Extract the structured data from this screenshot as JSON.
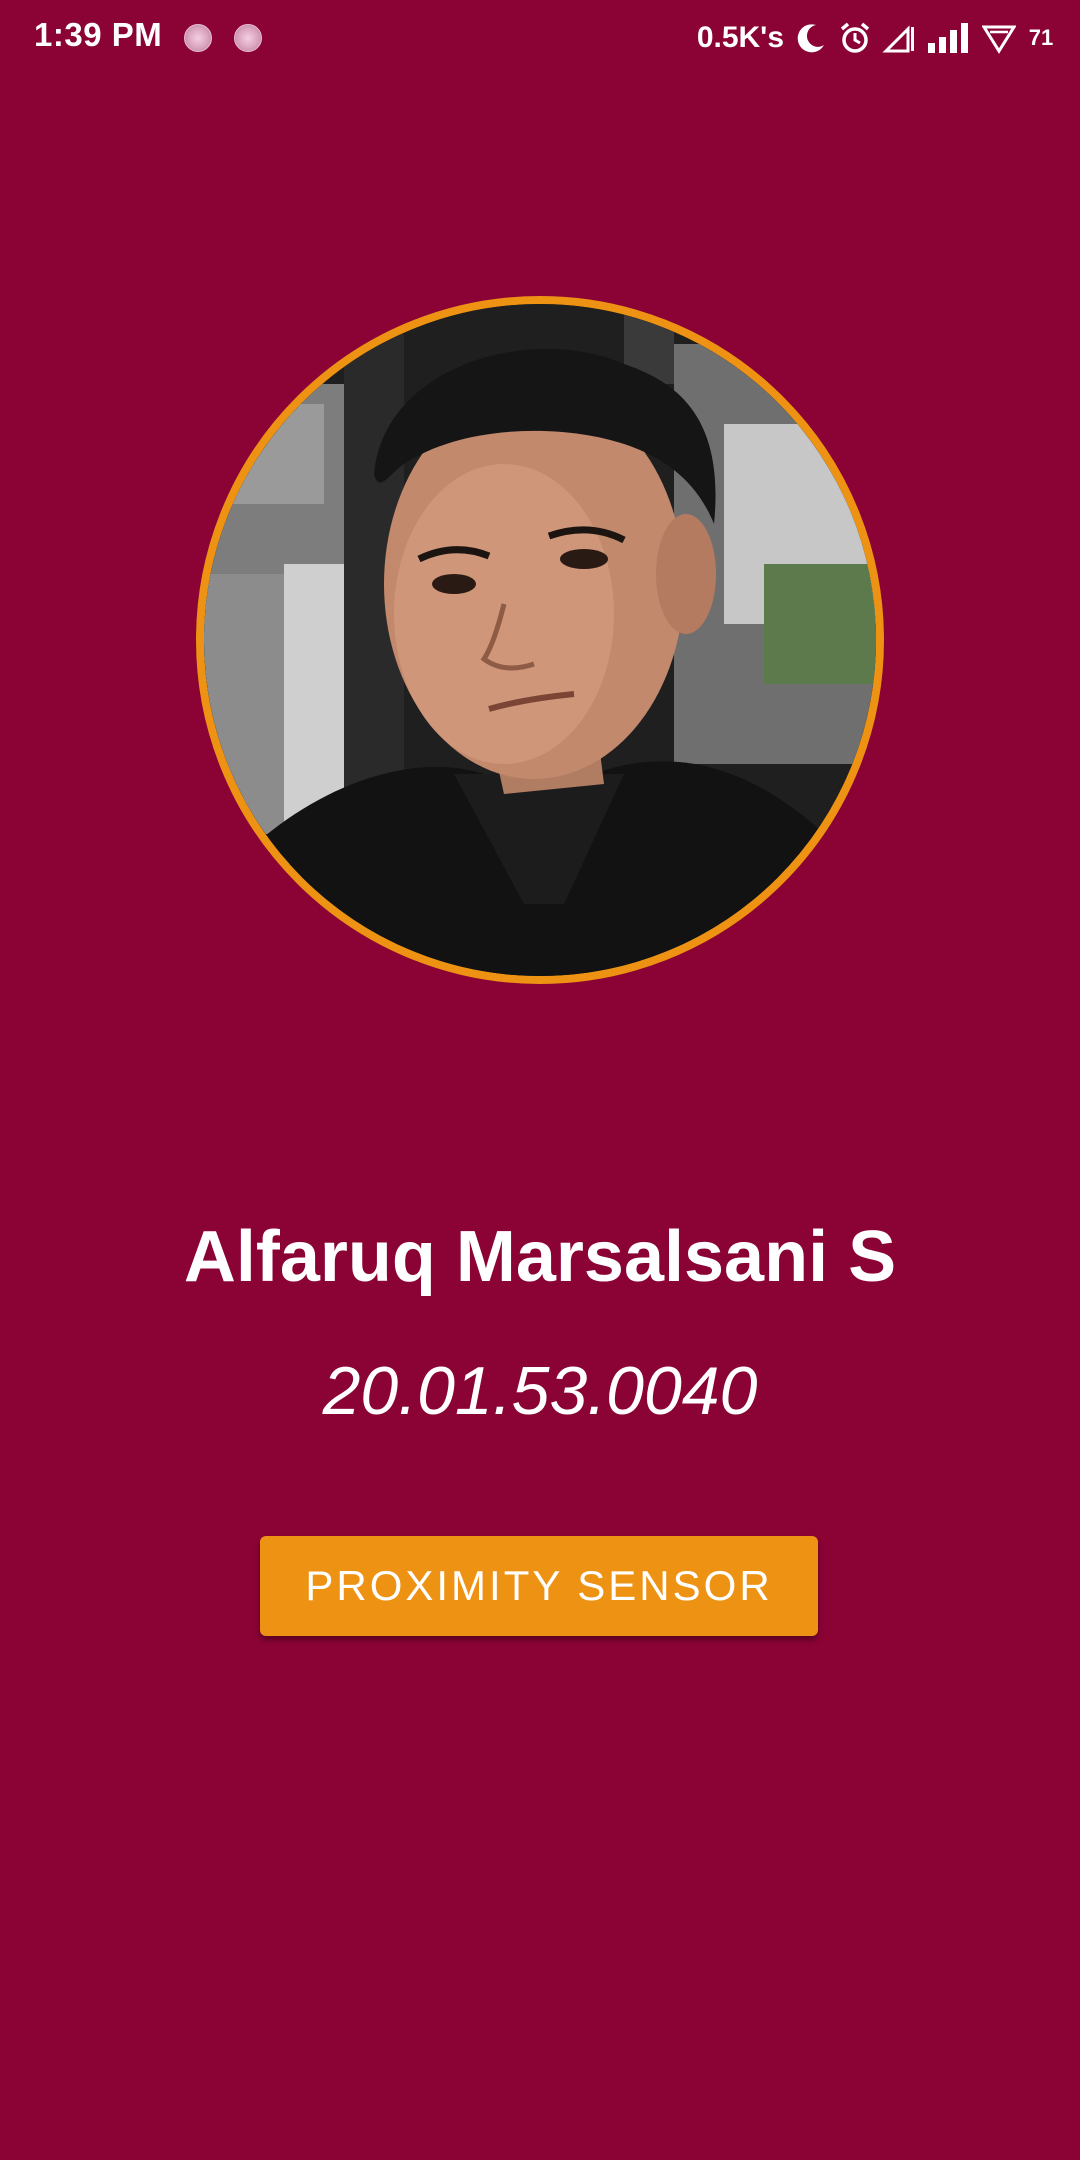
{
  "status_bar": {
    "time": "1:39 PM",
    "net_speed": "0.5K's",
    "battery": "71",
    "icons": [
      "notification-dot-icon",
      "notification-dot-icon",
      "moon-icon",
      "alarm-icon",
      "signal-empty-icon",
      "signal-full-icon",
      "wifi-icon",
      "battery-icon"
    ]
  },
  "profile": {
    "photo": "profile-photo",
    "name": "Alfaruq Marsalsani S",
    "student_id": "20.01.53.0040"
  },
  "actions": {
    "proximity_label": "PROXIMITY SENSOR"
  },
  "colors": {
    "background": "#8B0335",
    "accent": "#EE9214",
    "text": "#FFFFFF"
  }
}
